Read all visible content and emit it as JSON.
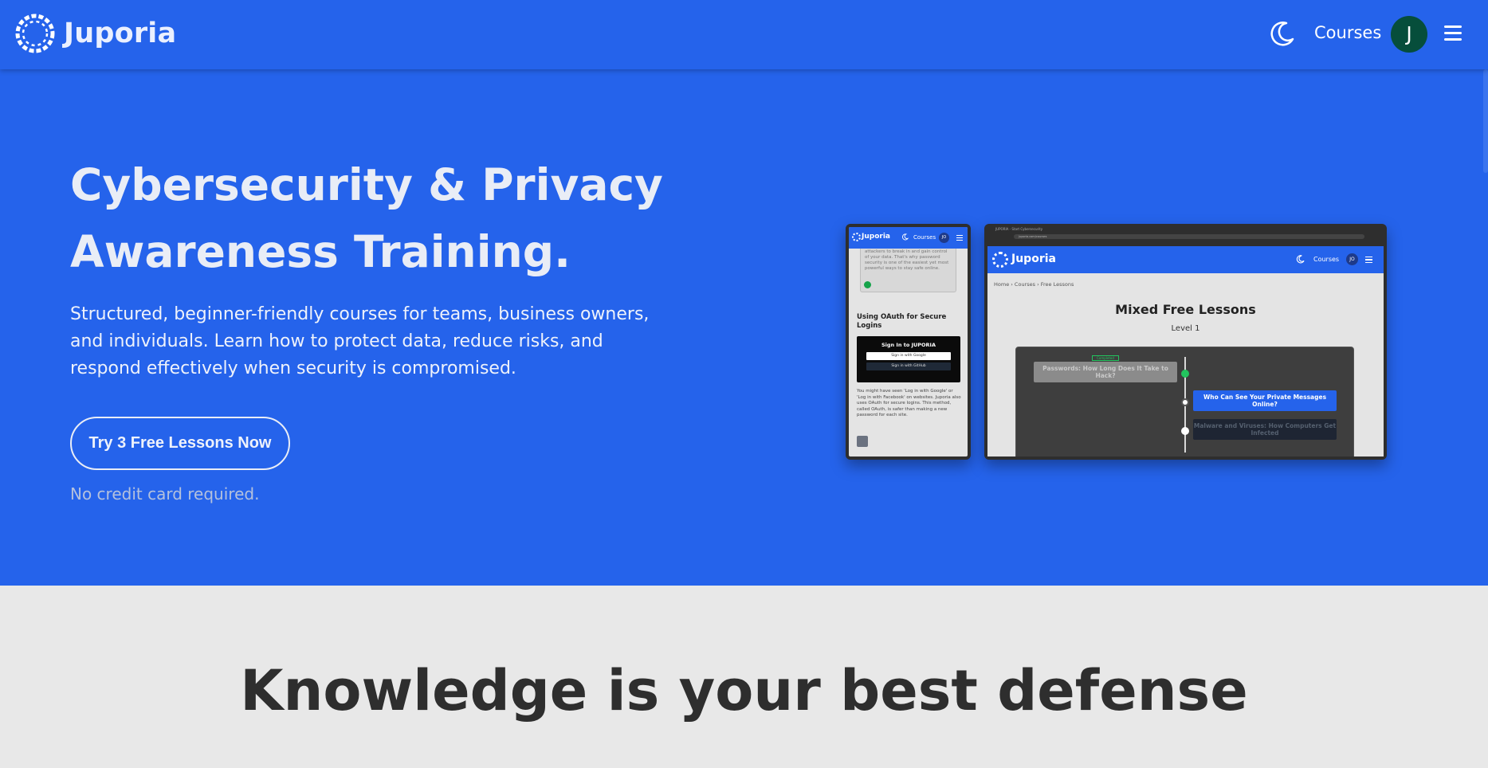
{
  "header": {
    "brand": "Juporia",
    "nav_courses": "Courses",
    "avatar_initial": "J",
    "icons": {
      "logo": "chain-ring-logo",
      "theme": "moon-icon",
      "menu": "hamburger-icon"
    }
  },
  "hero": {
    "title_line1": "Cybersecurity & Privacy",
    "title_line2": "Awareness Training.",
    "subtitle": "Structured, beginner-friendly courses for teams, business owners, and individuals. Learn how to protect data, reduce risks, and respond effectively when security is compromised.",
    "cta_label": "Try 3 Free Lessons Now",
    "note": "No credit card required."
  },
  "phone_mockup": {
    "brand": "Juporia",
    "courses": "Courses",
    "avatar": "JO",
    "card_text": "attackers to break in and gain control of your data. That's why password security is one of the easiest yet most powerful ways to stay safe online.",
    "heading": "Using OAuth for Secure Logins",
    "signin_title": "Sign In to JUPORIA",
    "signin_google": "Sign in with Google",
    "signin_github": "Sign in with GitHub",
    "paragraph": "You might have seen 'Log in with Google' or 'Log in with Facebook' on websites. Juporia also uses OAuth for secure logins. This method, called OAuth, is safer than making a new password for each site."
  },
  "laptop_mockup": {
    "tab_text": "JUPORIA - Start Cybersecurity",
    "url_text": "juporia.com/courses",
    "brand": "Juporia",
    "courses": "Courses",
    "avatar": "JO",
    "breadcrumb": "Home   ›   Courses   ›   Free Lessons",
    "title": "Mixed Free Lessons",
    "level": "Level 1",
    "tag": "Completed",
    "lesson1": "Passwords: How Long Does It Take to Hack?",
    "lesson2": "Who Can See Your Private Messages Online?",
    "lesson3": "Malware and Viruses: How Computers Get Infected"
  },
  "section2": {
    "title": "Knowledge is your best defense"
  },
  "colors": {
    "primary": "#2563eb",
    "avatar_bg": "#064e3b",
    "page_bg": "#e8e8e8",
    "heading_dark": "#2e2e2e"
  }
}
